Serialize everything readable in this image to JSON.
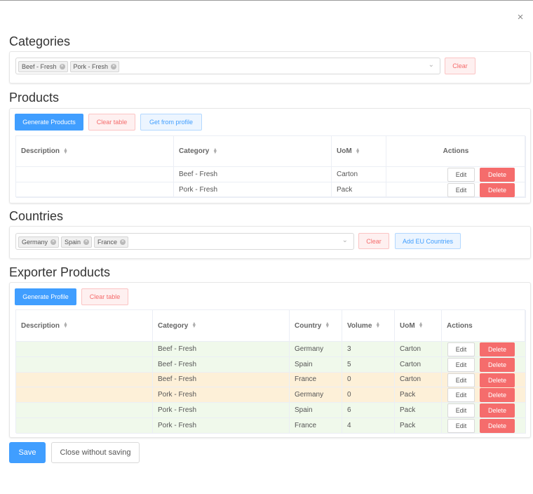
{
  "dialog": {
    "close_glyph": "×"
  },
  "categories": {
    "title": "Categories",
    "selected": [
      "Beef - Fresh",
      "Pork - Fresh"
    ],
    "clear_label": "Clear"
  },
  "products": {
    "title": "Products",
    "generate_label": "Generate Products",
    "clear_table_label": "Clear table",
    "get_profile_label": "Get from profile",
    "columns": [
      "Description",
      "Category",
      "UoM",
      "Actions"
    ],
    "rows": [
      {
        "description": "",
        "category": "Beef - Fresh",
        "uom": "Carton"
      },
      {
        "description": "",
        "category": "Pork - Fresh",
        "uom": "Pack"
      }
    ]
  },
  "countries": {
    "title": "Countries",
    "selected": [
      "Germany",
      "Spain",
      "France"
    ],
    "clear_label": "Clear",
    "add_eu_label": "Add EU Countries"
  },
  "exporter": {
    "title": "Exporter Products",
    "generate_label": "Generate Profile",
    "clear_table_label": "Clear table",
    "columns": [
      "Description",
      "Category",
      "Country",
      "Volume",
      "UoM",
      "Actions"
    ],
    "rows": [
      {
        "description": "",
        "category": "Beef - Fresh",
        "country": "Germany",
        "volume": "3",
        "uom": "Carton",
        "status": "ok"
      },
      {
        "description": "",
        "category": "Beef - Fresh",
        "country": "Spain",
        "volume": "5",
        "uom": "Carton",
        "status": "ok"
      },
      {
        "description": "",
        "category": "Beef - Fresh",
        "country": "France",
        "volume": "0",
        "uom": "Carton",
        "status": "warning"
      },
      {
        "description": "",
        "category": "Pork - Fresh",
        "country": "Germany",
        "volume": "0",
        "uom": "Pack",
        "status": "warning"
      },
      {
        "description": "",
        "category": "Pork - Fresh",
        "country": "Spain",
        "volume": "6",
        "uom": "Pack",
        "status": "ok"
      },
      {
        "description": "",
        "category": "Pork - Fresh",
        "country": "France",
        "volume": "4",
        "uom": "Pack",
        "status": "ok"
      }
    ]
  },
  "actions": {
    "edit_label": "Edit",
    "delete_label": "Delete"
  },
  "footer": {
    "save_label": "Save",
    "close_label": "Close without saving"
  },
  "colors": {
    "primary": "#409eff",
    "danger": "#f56c6c",
    "row_ok": "#f0f9eb",
    "row_warning": "#fdf0d8"
  }
}
